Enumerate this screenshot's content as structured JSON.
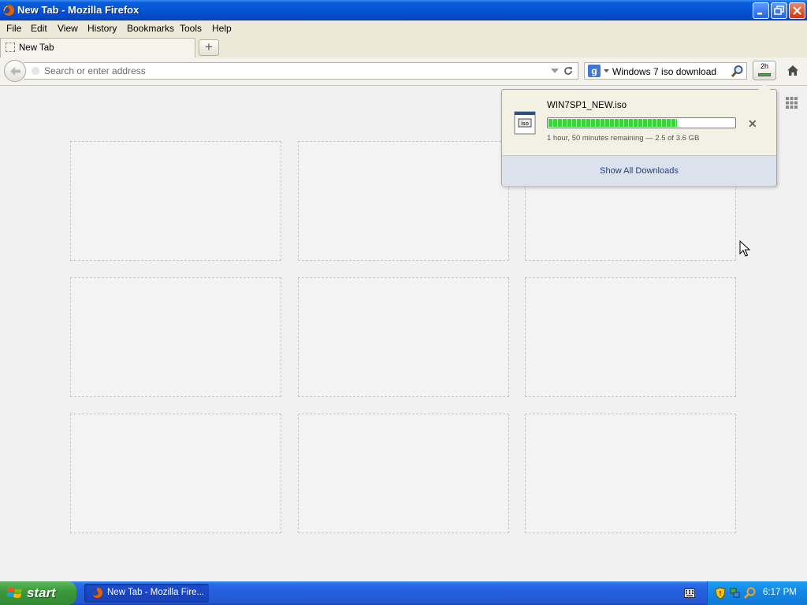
{
  "window": {
    "title": "New Tab - Mozilla Firefox",
    "controls": [
      "minimize",
      "restore",
      "close"
    ]
  },
  "menubar": {
    "items": [
      "File",
      "Edit",
      "View",
      "History",
      "Bookmarks",
      "Tools",
      "Help"
    ]
  },
  "tabs": [
    {
      "label": "New Tab",
      "active": true
    }
  ],
  "navbar": {
    "url_placeholder": "Search or enter address",
    "search_engine_icon": "google-icon",
    "search_value": "Windows 7 iso download",
    "downloads_button_time": "2h",
    "downloads_progress": 0.69
  },
  "new_tab_page": {
    "tiles_rows": 3,
    "tiles_cols": 3
  },
  "downloads_panel": {
    "filename": "WIN7SP1_NEW.iso",
    "progress": 0.69,
    "status": "1 hour, 50 minutes remaining — 2.5 of 3.6 GB",
    "show_all_label": "Show All Downloads"
  },
  "taskbar": {
    "start_label": "start",
    "task_label": "New Tab - Mozilla Fire...",
    "clock": "6:17 PM"
  },
  "colors": {
    "titlebar_blue": "#0654d4",
    "progress_green": "#3bd33b",
    "start_green": "#3c9a3c",
    "taskbar_blue": "#245fdb"
  }
}
